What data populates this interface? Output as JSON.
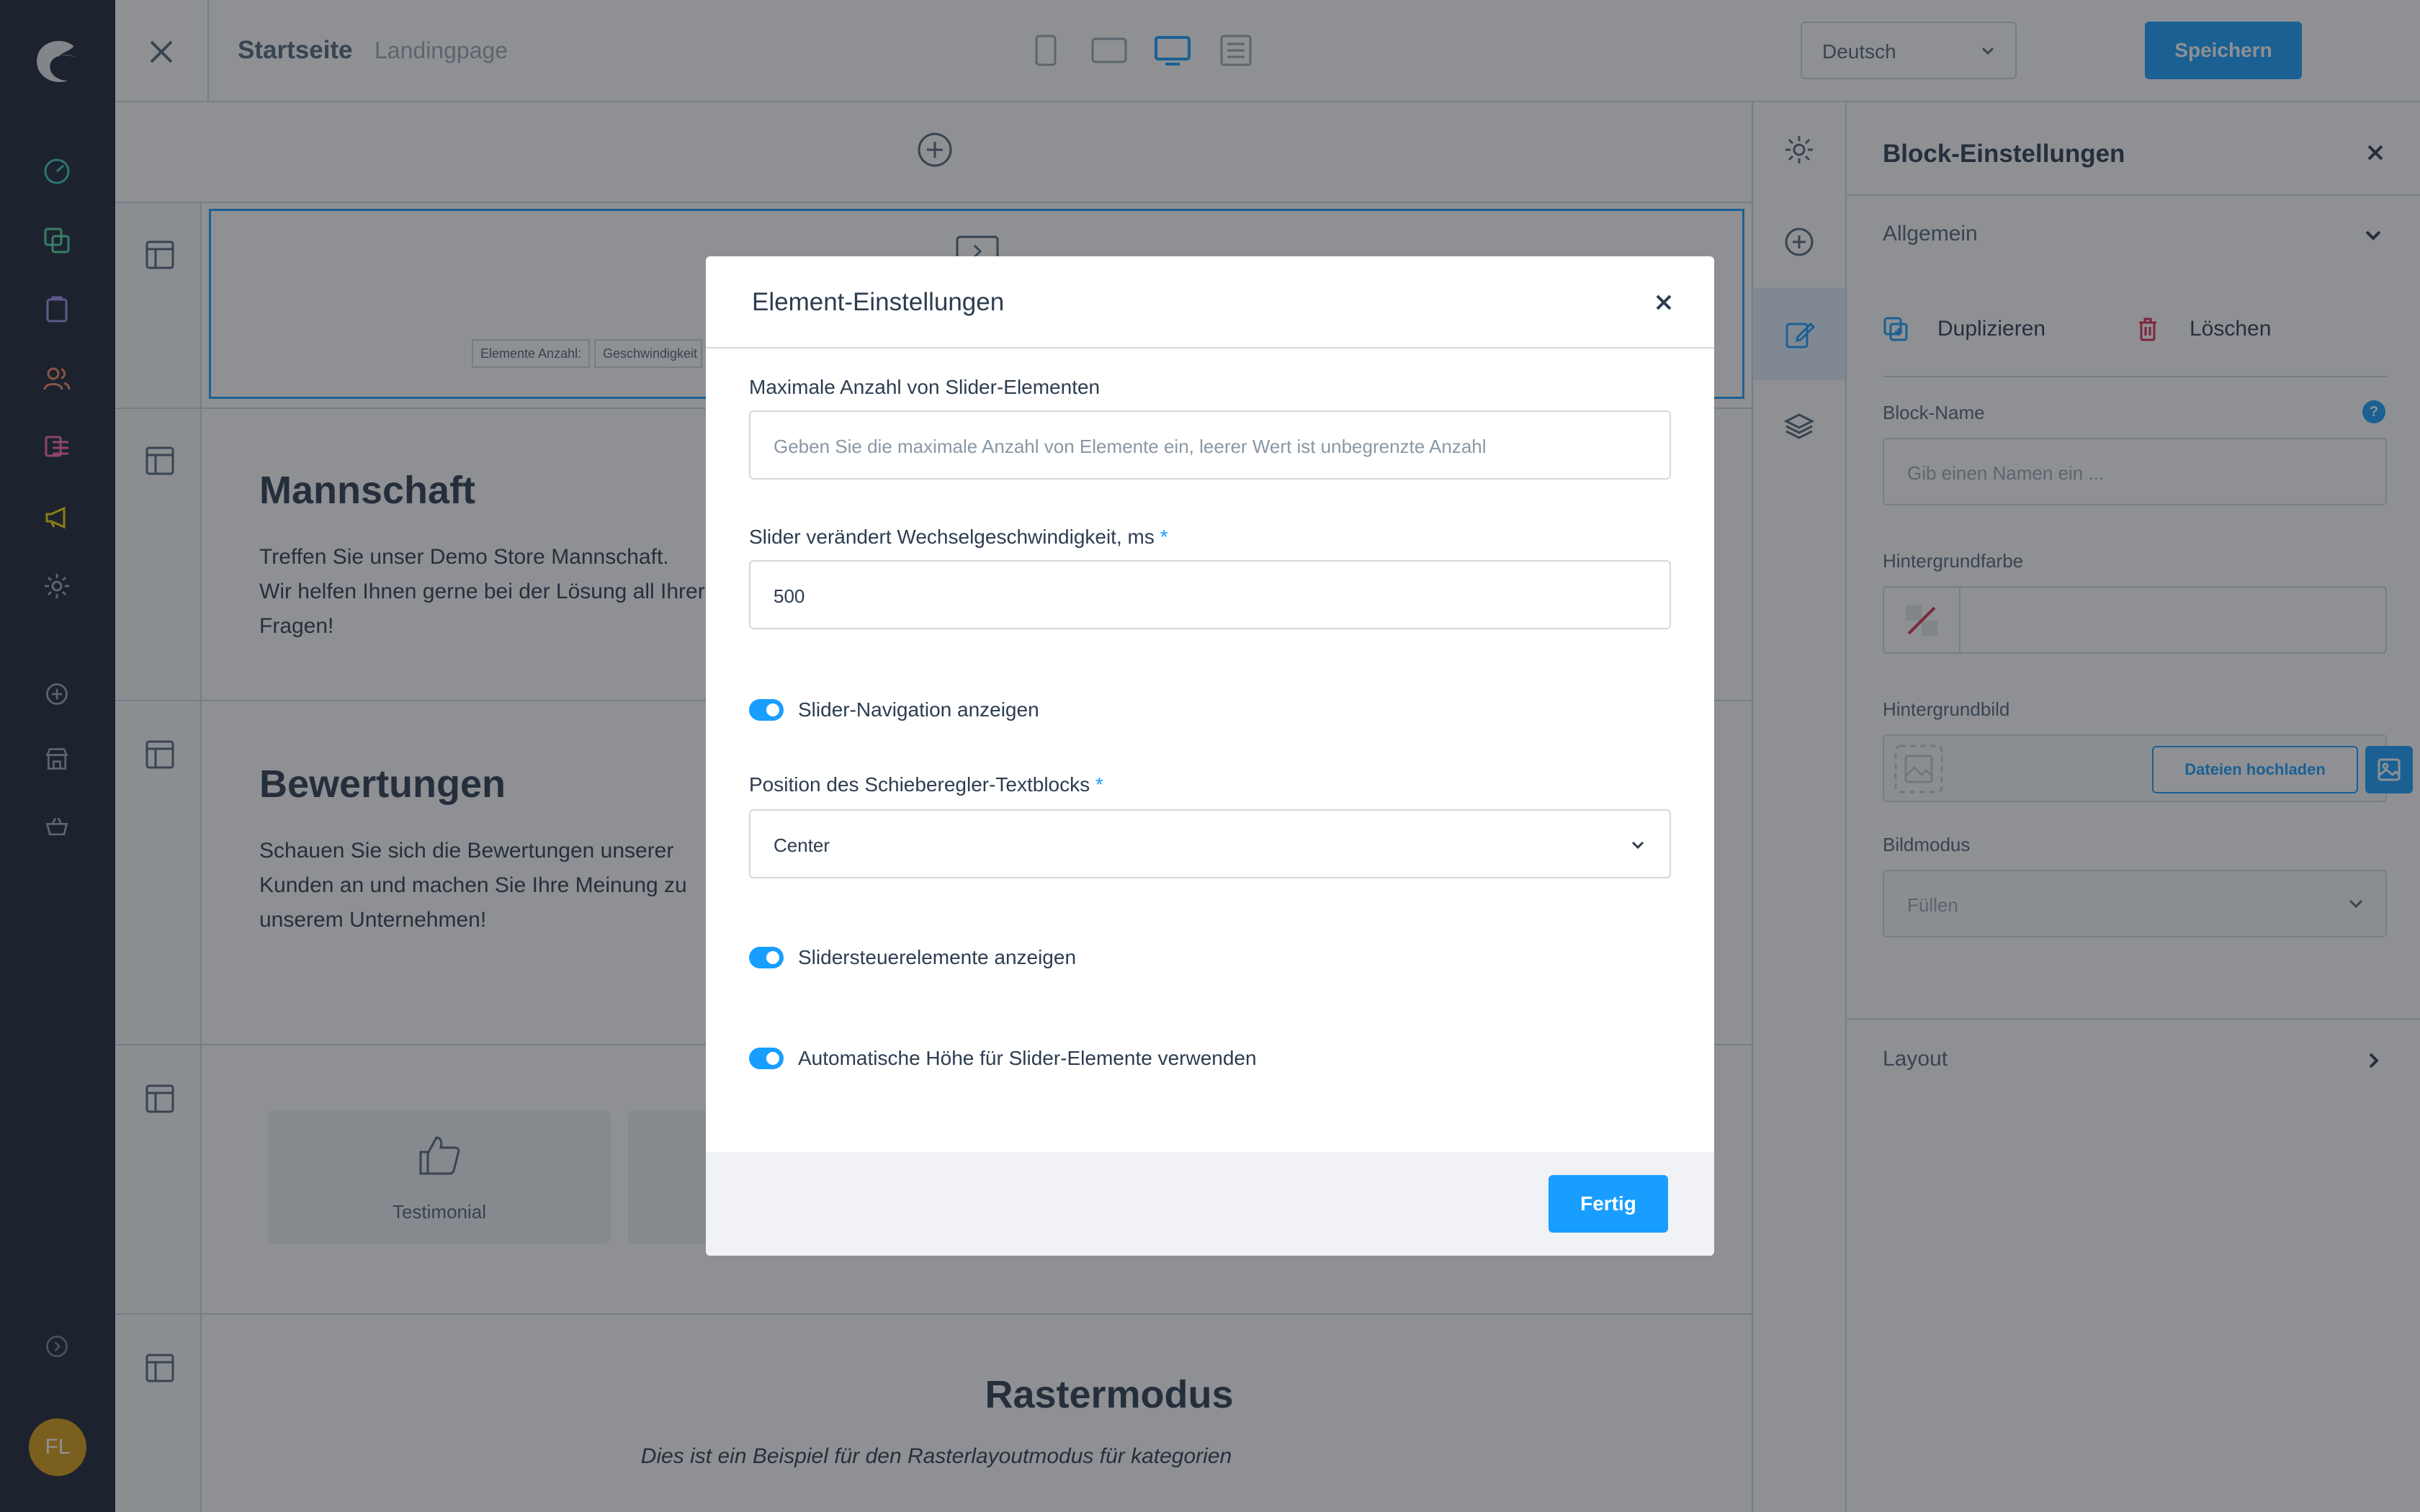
{
  "topbar": {
    "title": "Startseite",
    "subtitle": "Landingpage",
    "language": "Deutsch",
    "save_label": "Speichern"
  },
  "app_nav": {
    "avatar_initials": "FL",
    "icons": [
      "dashboard-icon",
      "catalog-icon",
      "orders-icon",
      "customers-icon",
      "content-icon",
      "marketing-icon",
      "settings-icon",
      "add-extension-icon",
      "sales-channel-icon",
      "basket-icon",
      "collapse-icon"
    ]
  },
  "canvas": {
    "chips": [
      "Elemente Anzahl:",
      "Geschwindigkeit"
    ],
    "blocks": [
      {
        "heading": "Mannschaft",
        "text": "Treffen Sie unser Demo Store Mannschaft. Wir helfen Ihnen gerne bei der Lösung all Ihrer Fragen!"
      },
      {
        "heading": "Bewertungen",
        "text": "Schauen Sie sich die Bewertungen unserer Kunden an und machen Sie Ihre Meinung zu unserem Unternehmen!"
      }
    ],
    "testimonial_label": "Testimonial",
    "raster_title": "Rastermodus",
    "raster_text": "Dies ist ein Beispiel für den Rasterlayoutmodus für kategorien"
  },
  "panel": {
    "title": "Block-Einstellungen",
    "general_section": "Allgemein",
    "duplicate_label": "Duplizieren",
    "delete_label": "Löschen",
    "block_name_label": "Block-Name",
    "block_name_placeholder": "Gib einen Namen ein ...",
    "help": "?",
    "bg_color_label": "Hintergrundfarbe",
    "bg_image_label": "Hintergrundbild",
    "upload_label": "Dateien hochladen",
    "image_mode_label": "Bildmodus",
    "image_mode_value": "Füllen",
    "layout_section": "Layout"
  },
  "modal": {
    "title": "Element-Einstellungen",
    "max_items_label": "Maximale Anzahl von Slider-Elementen",
    "max_items_placeholder": "Geben Sie die maximale Anzahl von Elemente ein, leerer Wert ist unbegrenzte Anzahl",
    "speed_label": "Slider verändert Wechselgeschwindigkeit, ms",
    "speed_value": "500",
    "required_mark": "*",
    "toggle_navigation": "Slider-Navigation anzeigen",
    "toggle_navigation_on": true,
    "position_label": "Position des Schieberegler-Textblocks",
    "position_value": "Center",
    "toggle_controls": "Slidersteuerelemente anzeigen",
    "toggle_controls_on": true,
    "toggle_auto_height": "Automatische Höhe für Slider-Elemente verwenden",
    "toggle_auto_height_on": true,
    "done_label": "Fertig"
  },
  "colors": {
    "accent": "#189eff",
    "sidebar_bg": "#1a2535",
    "avatar": "#d99c14",
    "delete": "#de294c"
  }
}
